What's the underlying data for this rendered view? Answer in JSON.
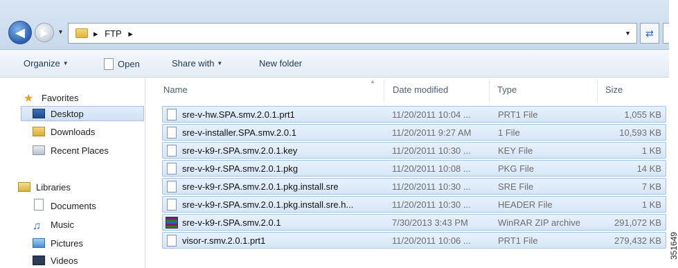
{
  "address": {
    "breadcrumb": [
      "▸",
      "FTP",
      "▸"
    ],
    "refresh_icon": "refresh-icon"
  },
  "toolbar": {
    "organize": "Organize",
    "open": "Open",
    "share_with": "Share with",
    "new_folder": "New folder"
  },
  "navpane": {
    "favorites": "Favorites",
    "desktop": "Desktop",
    "downloads": "Downloads",
    "recent_places": "Recent Places",
    "libraries": "Libraries",
    "documents": "Documents",
    "music": "Music",
    "pictures": "Pictures",
    "videos": "Videos"
  },
  "filelist": {
    "columns": {
      "name": "Name",
      "date": "Date modified",
      "type": "Type",
      "size": "Size"
    },
    "rows": [
      {
        "name": "sre-v-hw.SPA.smv.2.0.1.prt1",
        "date": "11/20/2011 10:04 ...",
        "type": "PRT1 File",
        "size": "1,055 KB",
        "icon": "file-icon"
      },
      {
        "name": "sre-v-installer.SPA.smv.2.0.1",
        "date": "11/20/2011 9:27 AM",
        "type": "1 File",
        "size": "10,593 KB",
        "icon": "file-icon"
      },
      {
        "name": "sre-v-k9-r.SPA.smv.2.0.1.key",
        "date": "11/20/2011 10:30 ...",
        "type": "KEY File",
        "size": "1 KB",
        "icon": "file-icon"
      },
      {
        "name": "sre-v-k9-r.SPA.smv.2.0.1.pkg",
        "date": "11/20/2011 10:08 ...",
        "type": "PKG File",
        "size": "14 KB",
        "icon": "file-icon"
      },
      {
        "name": "sre-v-k9-r.SPA.smv.2.0.1.pkg.install.sre",
        "date": "11/20/2011 10:30 ...",
        "type": "SRE File",
        "size": "7 KB",
        "icon": "file-icon"
      },
      {
        "name": "sre-v-k9-r.SPA.smv.2.0.1.pkg.install.sre.h...",
        "date": "11/20/2011 10:30 ...",
        "type": "HEADER File",
        "size": "1 KB",
        "icon": "file-icon"
      },
      {
        "name": "sre-v-k9-r.SPA.smv.2.0.1",
        "date": "7/30/2013 3:43 PM",
        "type": "WinRAR ZIP archive",
        "size": "291,072 KB",
        "icon": "winrar-icon"
      },
      {
        "name": "visor-r.smv.2.0.1.prt1",
        "date": "11/20/2011 10:06 ...",
        "type": "PRT1 File",
        "size": "279,432 KB",
        "icon": "file-icon"
      }
    ]
  },
  "watermark": "351649"
}
